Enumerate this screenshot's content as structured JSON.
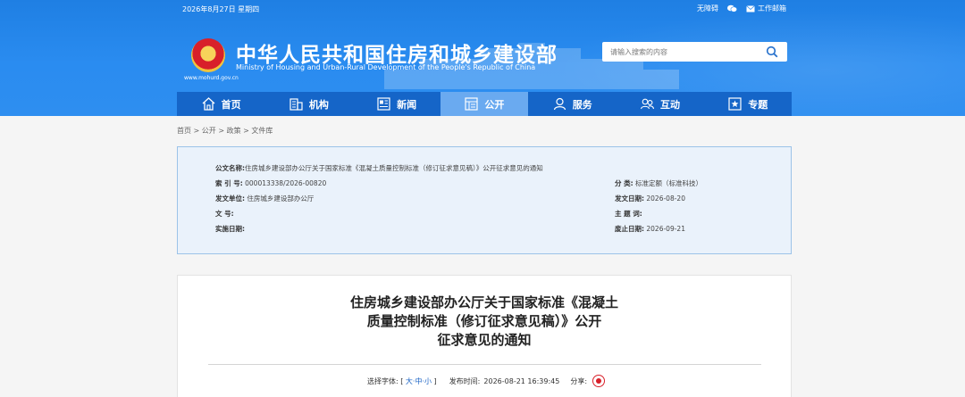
{
  "topbar": {
    "date": "2026年8月27日 星期四",
    "accessibility": "无障碍",
    "work_email": "工作邮箱"
  },
  "site": {
    "title": "中华人民共和国住房和城乡建设部",
    "subtitle": "Ministry of Housing and Urban-Rural Development of the People's Republic of China",
    "url": "www.mohurd.gov.cn"
  },
  "search": {
    "placeholder": "请输入搜索的内容"
  },
  "nav": [
    {
      "label": "首页",
      "icon": "home-icon"
    },
    {
      "label": "机构",
      "icon": "building-icon"
    },
    {
      "label": "新闻",
      "icon": "news-icon"
    },
    {
      "label": "公开",
      "icon": "document-icon",
      "active": true
    },
    {
      "label": "服务",
      "icon": "person-icon"
    },
    {
      "label": "互动",
      "icon": "people-icon"
    },
    {
      "label": "专题",
      "icon": "star-icon"
    }
  ],
  "breadcrumb": "首页 > 公开 > 政策 > 文件库",
  "info": {
    "title_label": "公文名称:",
    "title_value": "住房城乡建设部办公厅关于国家标准《混凝土质量控制标准（修订征求意见稿）》公开征求意见的通知",
    "index_label": "索 引 号:",
    "index_value": "000013338/2026-00820",
    "category_label": "分 类:",
    "category_value": "标准定额（标准科技）",
    "issuer_label": "发文单位:",
    "issuer_value": "住房城乡建设部办公厅",
    "date_label": "发文日期:",
    "date_value": "2026-08-20",
    "docno_label": "文 号:",
    "docno_value": "",
    "subject_label": "主 题 词:",
    "subject_value": "",
    "effective_label": "实施日期:",
    "effective_value": "",
    "deadline_label": "废止日期:",
    "deadline_value": "2026-09-21"
  },
  "article": {
    "title_line1": "住房城乡建设部办公厅关于国家标准《混凝土",
    "title_line2": "质量控制标准（修订征求意见稿）》公开",
    "title_line3": "征求意见的通知",
    "font_label": "选择字体:",
    "font_large": "大",
    "font_medium": "中",
    "font_small": "小",
    "time_label": "发布时间:",
    "time_value": "2026-08-21 16:39:45",
    "share_label": "分享:"
  }
}
